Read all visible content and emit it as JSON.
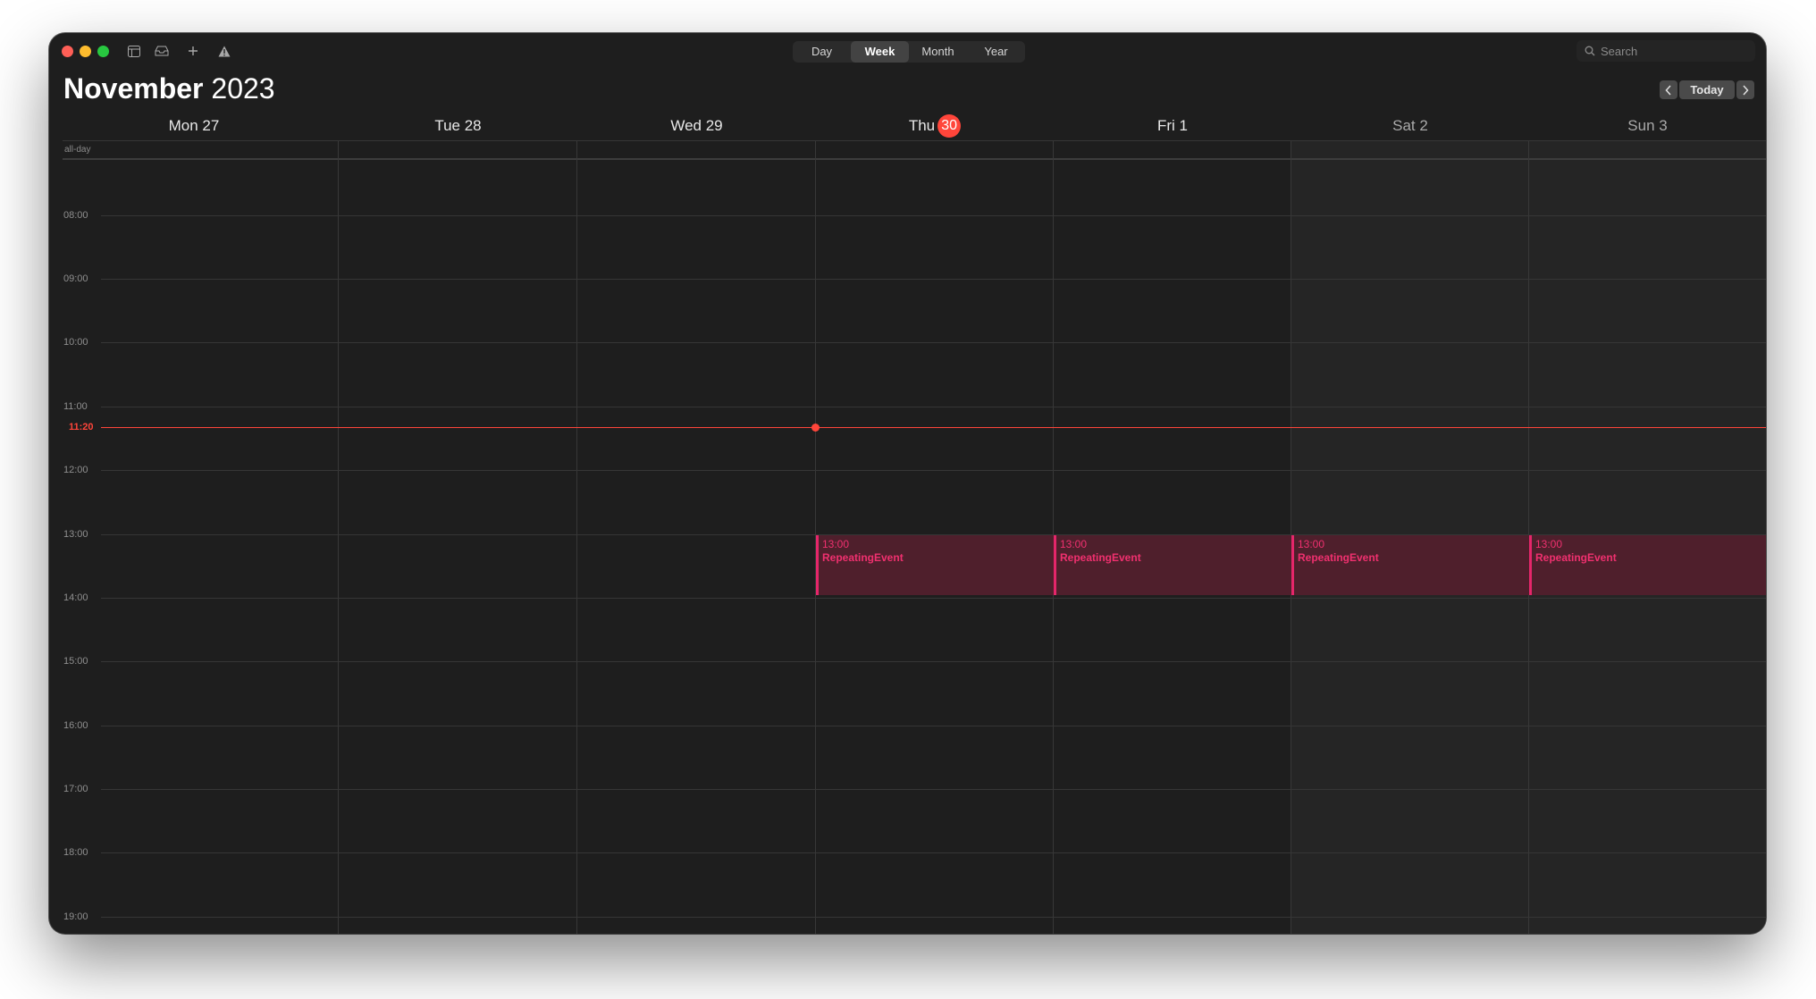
{
  "window": {
    "controls": [
      "close",
      "minimize",
      "zoom"
    ]
  },
  "toolbar": {
    "icons": [
      "calendar-list-icon",
      "inbox-icon",
      "plus-icon",
      "warning-icon"
    ],
    "views": [
      "Day",
      "Week",
      "Month",
      "Year"
    ],
    "active_view": "Week",
    "search_placeholder": "Search"
  },
  "header": {
    "month": "November",
    "year": "2023",
    "today_label": "Today",
    "prev_icon": "chevron-left-icon",
    "next_icon": "chevron-right-icon"
  },
  "days": [
    {
      "label": "Mon 27",
      "weekday": "Mon",
      "date": "27",
      "today": false,
      "weekend": false
    },
    {
      "label": "Tue 28",
      "weekday": "Tue",
      "date": "28",
      "today": false,
      "weekend": false
    },
    {
      "label": "Wed 29",
      "weekday": "Wed",
      "date": "29",
      "today": false,
      "weekend": false
    },
    {
      "label": "Thu 30",
      "weekday": "Thu",
      "date": "30",
      "today": true,
      "weekend": false
    },
    {
      "label": "Fri 1",
      "weekday": "Fri",
      "date": "1",
      "today": false,
      "weekend": false
    },
    {
      "label": "Sat 2",
      "weekday": "Sat",
      "date": "2",
      "today": false,
      "weekend": true
    },
    {
      "label": "Sun 3",
      "weekday": "Sun",
      "date": "3",
      "today": false,
      "weekend": true
    }
  ],
  "allday_label": "all-day",
  "hours": [
    "08:00",
    "09:00",
    "10:00",
    "11:00",
    "12:00",
    "13:00",
    "14:00",
    "15:00",
    "16:00",
    "17:00",
    "18:00",
    "19:00"
  ],
  "current_time": "11:20",
  "events": [
    {
      "day": "Thu 30",
      "time": "13:00",
      "title": "RepeatingEvent"
    },
    {
      "day": "Fri 1",
      "time": "13:00",
      "title": "RepeatingEvent"
    },
    {
      "day": "Sat 2",
      "time": "13:00",
      "title": "RepeatingEvent"
    },
    {
      "day": "Sun 3",
      "time": "13:00",
      "title": "RepeatingEvent"
    }
  ],
  "colors": {
    "background": "#1e1e1e",
    "today_accent": "#ff453a",
    "event_fill": "#4f1f2c",
    "event_accent": "#e5266a",
    "close": "#ff5f57",
    "minimize": "#febc2e",
    "zoom": "#28c840"
  }
}
